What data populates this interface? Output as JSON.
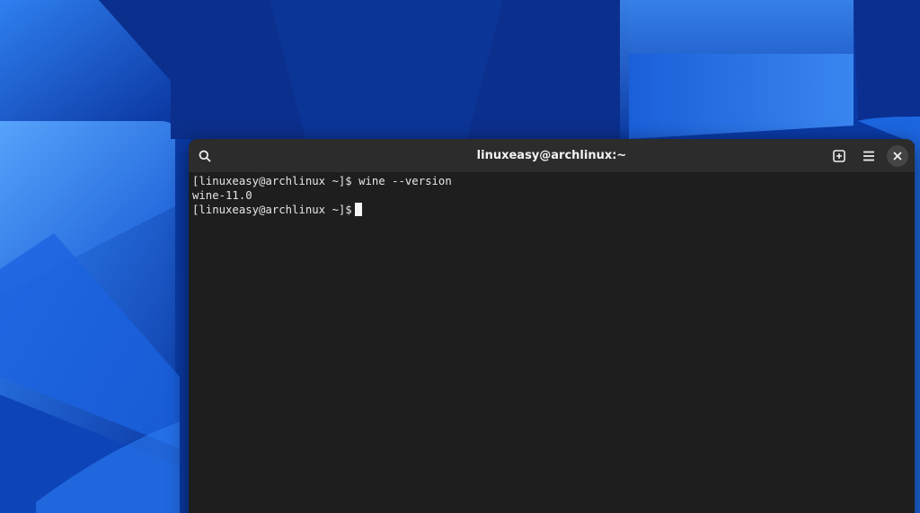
{
  "window": {
    "title": "linuxeasy@archlinux:~"
  },
  "toolbar": {
    "search_icon": "search-icon",
    "new_tab_icon": "new-tab-icon",
    "menu_icon": "hamburger-menu-icon",
    "close_icon": "close-icon"
  },
  "terminal": {
    "lines": [
      "[linuxeasy@archlinux ~]$ wine --version",
      "wine-11.0",
      "[linuxeasy@archlinux ~]$"
    ]
  },
  "colors": {
    "terminal_bg": "#1e1e1e",
    "titlebar_bg": "#2c2c2c",
    "text": "#e6e6e6",
    "wallpaper_blue": "#0b3fb0"
  }
}
